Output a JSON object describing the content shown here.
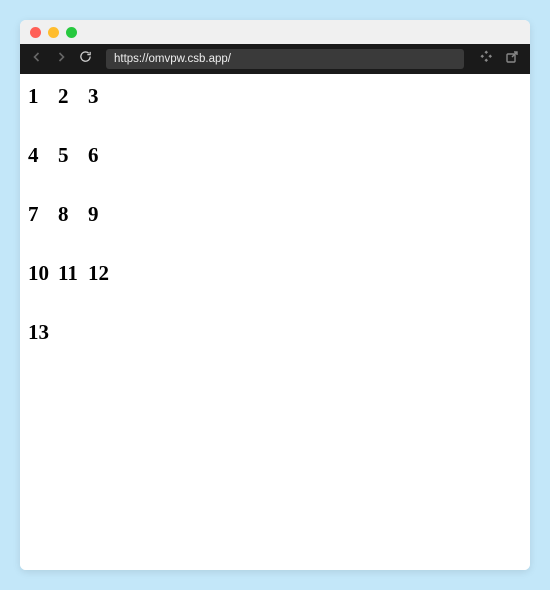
{
  "url": "https://omvpw.csb.app/",
  "numbers": [
    "1",
    "2",
    "3",
    "4",
    "5",
    "6",
    "7",
    "8",
    "9",
    "10",
    "11",
    "12",
    "13"
  ]
}
